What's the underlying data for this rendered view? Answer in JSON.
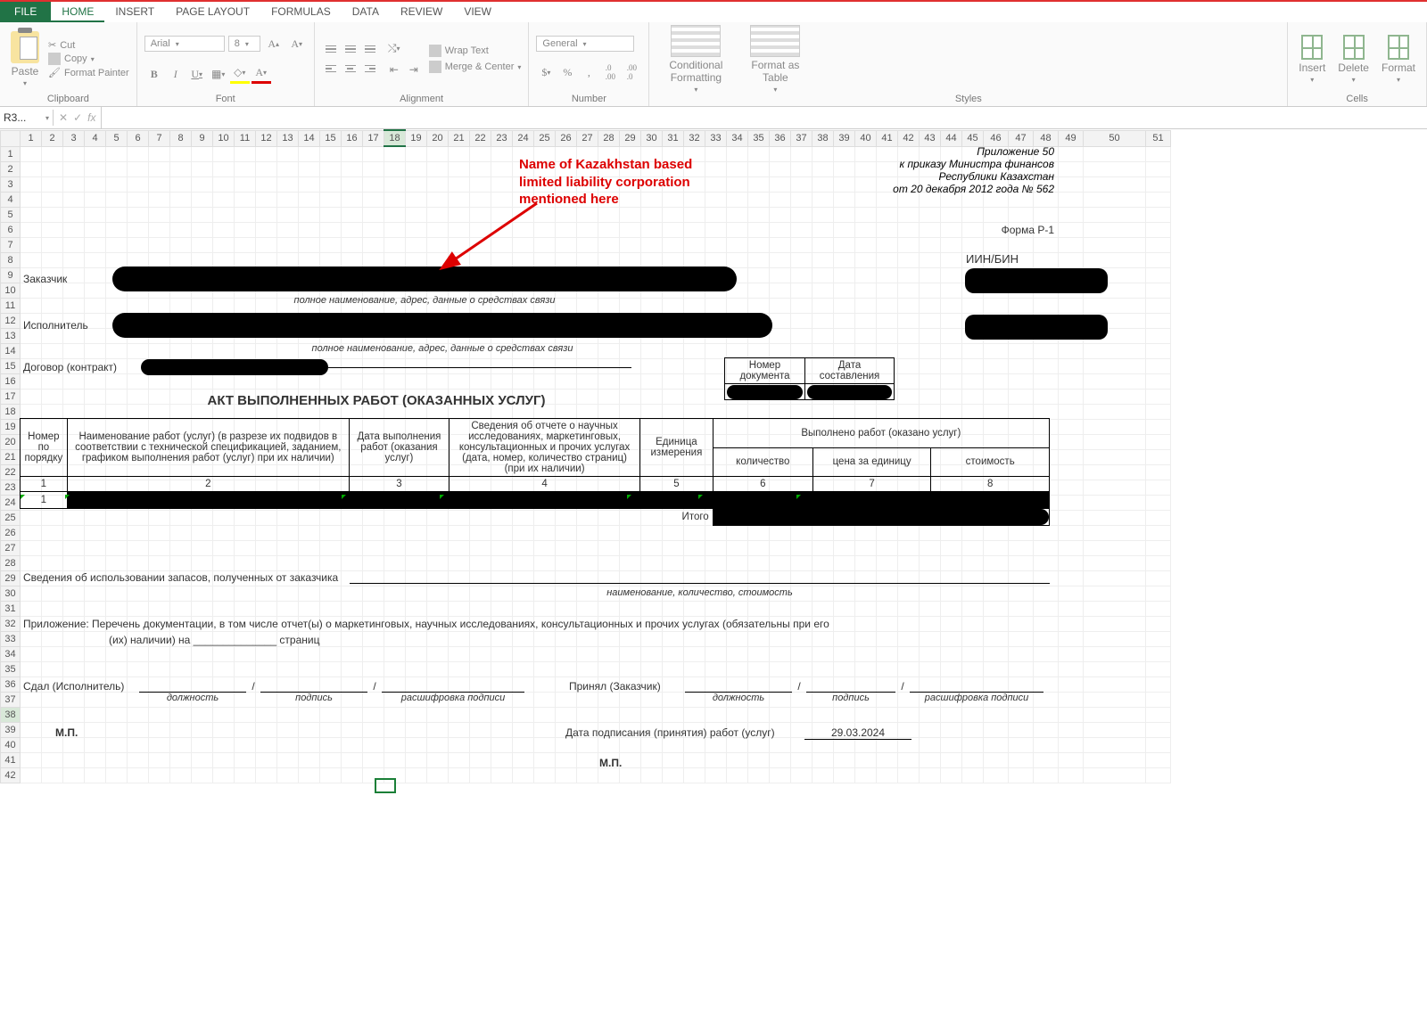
{
  "ribbon": {
    "tabs": {
      "file": "FILE",
      "home": "HOME",
      "insert": "INSERT",
      "pagelayout": "PAGE LAYOUT",
      "formulas": "FORMULAS",
      "data": "DATA",
      "review": "REVIEW",
      "view": "VIEW"
    },
    "clipboard": {
      "paste": "Paste",
      "cut": "Cut",
      "copy": "Copy",
      "painter": "Format Painter",
      "label": "Clipboard"
    },
    "font": {
      "name": "Arial",
      "size": "8",
      "label": "Font"
    },
    "alignment": {
      "wrap": "Wrap Text",
      "merge": "Merge & Center",
      "label": "Alignment"
    },
    "number": {
      "format": "General",
      "label": "Number"
    },
    "styles": {
      "cond": "Conditional Formatting",
      "formatas": "Format as Table",
      "label": "Styles"
    },
    "cells": {
      "insert": "Insert",
      "delete": "Delete",
      "format": "Format",
      "label": "Cells"
    }
  },
  "formula_bar": {
    "cellref": "R3...",
    "fx": "fx"
  },
  "annotation": {
    "line1": "Name of Kazakhstan based",
    "line2": "limited liability corporation",
    "line3": "mentioned here"
  },
  "doc": {
    "appendix_l1": "Приложение 50",
    "appendix_l2": "к приказу Министра финансов",
    "appendix_l3": "Республики Казахстан",
    "appendix_l4": "от 20 декабря 2012 года № 562",
    "form": "Форма Р-1",
    "iin": "ИИН/БИН",
    "customer": "Заказчик",
    "contractor": "Исполнитель",
    "fullname_note": "полное наименование, адрес, данные о средствах связи",
    "contract": "Договор (контракт)",
    "docnum": "Номер документа",
    "docdate": "Дата составления",
    "title": "АКТ ВЫПОЛНЕННЫХ РАБОТ (ОКАЗАННЫХ УСЛУГ)",
    "th_num": "Номер по порядку",
    "th_name": "Наименование работ (услуг) (в разрезе их подвидов в соответствии с технической спецификацией, заданием, графиком выполнения работ (услуг) при их наличии)",
    "th_date": "Дата выполнения работ (оказания услуг)",
    "th_report": "Сведения об отчете о научных исследованиях, маркетинговых, консультационных и прочих услугах (дата, номер, количество страниц) (при их наличии)",
    "th_unit": "Единица измерения",
    "th_done": "Выполнено работ (оказано услуг)",
    "th_qty": "количество",
    "th_price": "цена за единицу",
    "th_cost": "стоимость",
    "nums": [
      "1",
      "2",
      "3",
      "4",
      "5",
      "6",
      "7",
      "8"
    ],
    "data_row_num": "1",
    "total": "Итого",
    "inventory": "Сведения об использовании запасов, полученных от заказчика",
    "inventory_note": "наименование, количество, стоимость",
    "append_l1": "Приложение: Перечень документации, в том числе отчет(ы) о маркетинговых, научных исследованиях, консультационных и прочих услугах (обязательны при его",
    "append_l2": "(их) наличии) на ______________ страниц",
    "handed": "Сдал (Исполнитель)",
    "accepted": "Принял (Заказчик)",
    "slash": "/",
    "position": "должность",
    "signature": "подпись",
    "decoded": "расшифровка подписи",
    "mp": "М.П.",
    "sign_date_lbl": "Дата подписания (принятия) работ (услуг)",
    "sign_date": "29.03.2024"
  },
  "chart_data": {
    "type": "table",
    "title": "АКТ ВЫПОЛНЕННЫХ РАБОТ (ОКАЗАННЫХ УСЛУГ)",
    "columns": [
      "Номер по порядку",
      "Наименование работ (услуг)",
      "Дата выполнения работ (оказания услуг)",
      "Сведения об отчете",
      "Единица измерения",
      "количество",
      "цена за единицу",
      "стоимость"
    ],
    "column_numbers": [
      1,
      2,
      3,
      4,
      5,
      6,
      7,
      8
    ],
    "rows": [
      {
        "num": 1,
        "name": "[redacted]",
        "date": "[redacted]",
        "report": "[redacted]",
        "unit": "[redacted]",
        "qty": "[redacted]",
        "price": "[redacted]",
        "cost": "[redacted]"
      }
    ],
    "total_row": {
      "label": "Итого",
      "cost": "[redacted]"
    },
    "sign_date": "29.03.2024"
  }
}
